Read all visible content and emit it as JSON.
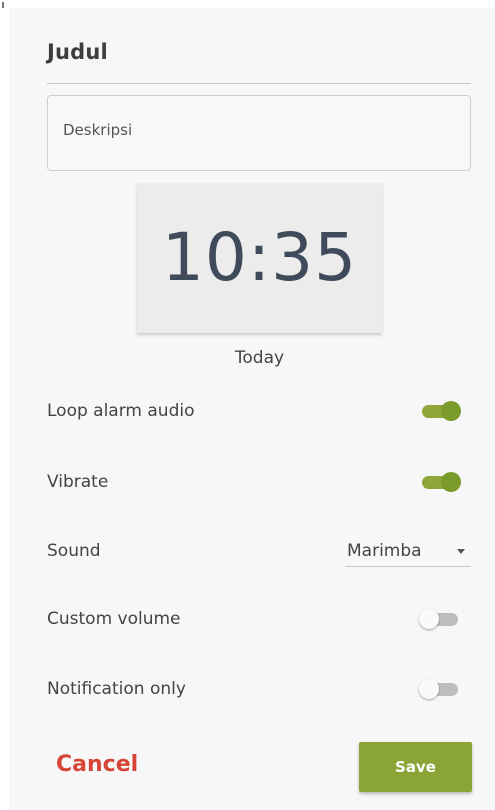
{
  "form": {
    "title_value": "Judul",
    "description_placeholder": "Deskripsi",
    "time": "10:35",
    "date_label": "Today"
  },
  "settings": {
    "loop_alarm_audio": {
      "label": "Loop alarm audio",
      "enabled": true
    },
    "vibrate": {
      "label": "Vibrate",
      "enabled": true
    },
    "sound": {
      "label": "Sound",
      "selected": "Marimba"
    },
    "custom_volume": {
      "label": "Custom volume",
      "enabled": false
    },
    "notification_only": {
      "label": "Notification only",
      "enabled": false
    }
  },
  "actions": {
    "cancel_label": "Cancel",
    "save_label": "Save"
  },
  "colors": {
    "accent": "#8aa536",
    "cancel": "#d64537"
  }
}
